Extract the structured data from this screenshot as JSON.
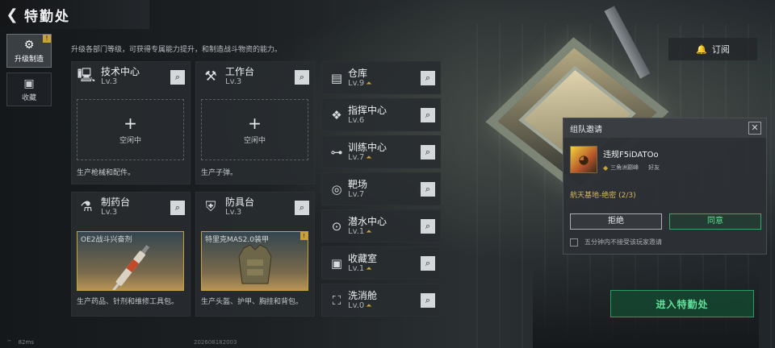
{
  "header": {
    "title": "特勤处"
  },
  "nav": [
    {
      "label": "升级制造",
      "icon": "upgrade-icon",
      "badge": "!"
    },
    {
      "label": "收藏",
      "icon": "collection-icon"
    }
  ],
  "subtitle": "升级各部门等级，可获得专属能力提升，和制造战斗物资的能力。",
  "cards": {
    "tech": {
      "title": "技术中心",
      "level": "Lv.3",
      "idle": "空闲中",
      "desc": "生产枪械和配件。"
    },
    "workbench": {
      "title": "工作台",
      "level": "Lv.3",
      "idle": "空闲中",
      "desc": "生产子弹。"
    },
    "pharmacy": {
      "title": "制药台",
      "level": "Lv.3",
      "product": "OE2战斗兴奋剂",
      "desc": "生产药品、针剂和维修工具包。"
    },
    "armor": {
      "title": "防具台",
      "level": "Lv.3",
      "product": "特里克MAS2.0装甲",
      "desc": "生产头盔、护甲、胸挂和背包。"
    }
  },
  "rooms": [
    {
      "name": "仓库",
      "level": "Lv.9",
      "upgradable": true,
      "icon": "warehouse-icon"
    },
    {
      "name": "指挥中心",
      "level": "Lv.6",
      "upgradable": false,
      "icon": "command-icon"
    },
    {
      "name": "训练中心",
      "level": "Lv.7",
      "upgradable": true,
      "icon": "dumbbell-icon"
    },
    {
      "name": "靶场",
      "level": "Lv.7",
      "upgradable": false,
      "icon": "target-icon"
    },
    {
      "name": "潜水中心",
      "level": "Lv.1",
      "upgradable": true,
      "icon": "diving-icon"
    },
    {
      "name": "收藏室",
      "level": "Lv.1",
      "upgradable": true,
      "icon": "collection-room-icon"
    },
    {
      "name": "洗消舱",
      "level": "Lv.0",
      "upgradable": true,
      "icon": "decon-icon"
    }
  ],
  "subscribe": {
    "label": "订阅"
  },
  "invite": {
    "title": "组队邀请",
    "inviter_name": "违规F5iDATOo",
    "inviter_rank": "三角洲巅峰",
    "relation": "好友",
    "mission": "航天基地-绝密 (2/3)",
    "reject": "拒绝",
    "accept": "同意",
    "checkbox_label": "五分钟内不接受该玩家邀请"
  },
  "enter_button": "进入特勤处",
  "status": {
    "ping": "82ms",
    "build": "202608182003"
  },
  "colors": {
    "accent_green": "#5fe39a",
    "accent_gold": "#c7a23a",
    "panel": "#282c30"
  }
}
